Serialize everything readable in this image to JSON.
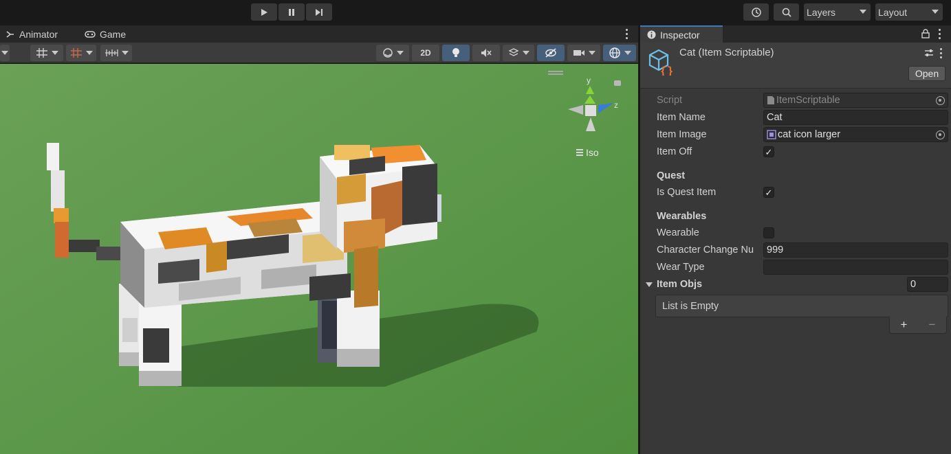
{
  "toolbar": {
    "play_icon": "play-icon",
    "pause_icon": "pause-icon",
    "step_icon": "step-icon",
    "history_icon": "history-icon",
    "search_icon": "search-icon",
    "layers_label": "Layers",
    "layout_label": "Layout"
  },
  "scene": {
    "tabs": [
      {
        "label": "Animator",
        "icon": "animator-icon"
      },
      {
        "label": "Game",
        "icon": "game-controller-icon"
      }
    ],
    "toolbar": {
      "mode_2d_label": "2D"
    },
    "gizmo": {
      "y_label": "y",
      "z_label": "z",
      "projection_label": "Iso"
    },
    "colors": {
      "ground": "#5e9a4a",
      "cat_white": "#f0f0f0",
      "cat_orange": "#e08a25",
      "cat_dark": "#3f3f3f"
    }
  },
  "inspector": {
    "tab_label": "Inspector",
    "title": "Cat (Item Scriptable)",
    "open_label": "Open",
    "fields": {
      "script": {
        "label": "Script",
        "value": "ItemScriptable"
      },
      "item_name": {
        "label": "Item Name",
        "value": "Cat"
      },
      "item_image": {
        "label": "Item Image",
        "value": "cat icon larger"
      },
      "item_off": {
        "label": "Item Off",
        "checked": true
      }
    },
    "quest": {
      "header": "Quest",
      "is_quest_item": {
        "label": "Is Quest Item",
        "checked": true
      }
    },
    "wearables": {
      "header": "Wearables",
      "wearable": {
        "label": "Wearable",
        "checked": false
      },
      "character_change": {
        "label": "Character Change Nu",
        "value": "999"
      },
      "wear_type": {
        "label": "Wear Type",
        "value": ""
      }
    },
    "item_objs": {
      "label": "Item Objs",
      "count": "0",
      "empty_text": "List is Empty",
      "add_label": "+",
      "remove_label": "−"
    },
    "check_mark": "✓"
  }
}
